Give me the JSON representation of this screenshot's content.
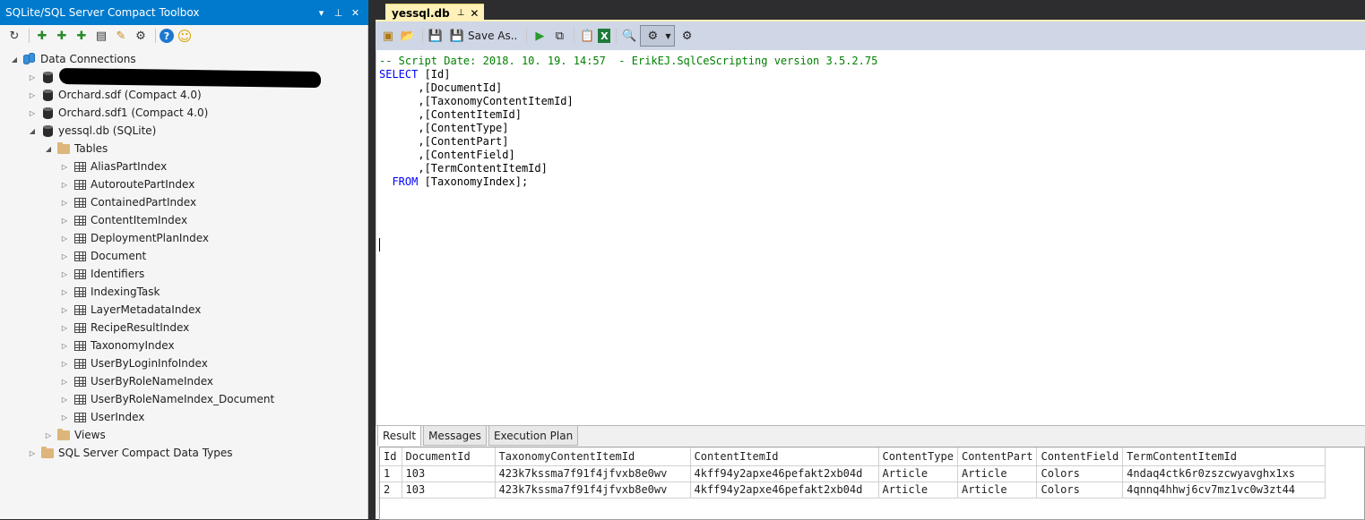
{
  "panel": {
    "title": "SQLite/SQL Server Compact Toolbox",
    "title_buttons": [
      "▾",
      "⊥",
      "✕"
    ],
    "toolbar_icons": [
      "refresh-icon",
      "add-sqlite-connection-icon",
      "add-ce-connection-icon",
      "add-server-connection-icon",
      "scan-icon",
      "script-icon",
      "settings-icon",
      "help-icon",
      "smiley-icon"
    ],
    "toolbar_glyphs": [
      "↻",
      "✚",
      "✚",
      "✚",
      "▤",
      "✎",
      "⚙",
      "?",
      "☺"
    ]
  },
  "tree": {
    "root_label": "Data Connections",
    "connections": [
      {
        "label": "",
        "redacted": true
      },
      {
        "label": "Orchard.sdf (Compact 4.0)"
      },
      {
        "label": "Orchard.sdf1 (Compact 4.0)"
      },
      {
        "label": "yessql.db (SQLite)"
      }
    ],
    "tables_label": "Tables",
    "tables": [
      "AliasPartIndex",
      "AutoroutePartIndex",
      "ContainedPartIndex",
      "ContentItemIndex",
      "DeploymentPlanIndex",
      "Document",
      "Identifiers",
      "IndexingTask",
      "LayerMetadataIndex",
      "RecipeResultIndex",
      "TaxonomyIndex",
      "UserByLoginInfoIndex",
      "UserByRoleNameIndex",
      "UserByRoleNameIndex_Document",
      "UserIndex"
    ],
    "views_label": "Views",
    "data_types_label": "SQL Server Compact Data Types"
  },
  "document_tab": {
    "label": "yessql.db",
    "pin": "⊥",
    "close": "✕"
  },
  "editor_toolbar": {
    "save_as_label": "Save As..",
    "glyphs": {
      "new": "▣",
      "open": "📂",
      "save": "💾",
      "save_as": "💾",
      "execute": "▶",
      "plan": "⧉",
      "clipboard": "📋",
      "excel": "X",
      "find": "🔍",
      "options": "⚙",
      "extra": "⚙"
    }
  },
  "code": [
    {
      "kind": "cm",
      "text": "-- Script Date: 2018. 10. 19. 14:57  - ErikEJ.SqlCeScripting version 3.5.2.75"
    },
    {
      "kind": "kw-first",
      "kw": "SELECT",
      "text": " [Id]"
    },
    {
      "kind": "pl",
      "text": "      ,[DocumentId]"
    },
    {
      "kind": "pl",
      "text": "      ,[TaxonomyContentItemId]"
    },
    {
      "kind": "pl",
      "text": "      ,[ContentItemId]"
    },
    {
      "kind": "pl",
      "text": "      ,[ContentType]"
    },
    {
      "kind": "pl",
      "text": "      ,[ContentPart]"
    },
    {
      "kind": "pl",
      "text": "      ,[ContentField]"
    },
    {
      "kind": "pl",
      "text": "      ,[TermContentItemId]"
    },
    {
      "kind": "kw-indent",
      "kw": "FROM",
      "text": " [TaxonomyIndex];"
    }
  ],
  "results": {
    "tabs": [
      "Result",
      "Messages",
      "Execution Plan"
    ],
    "columns": [
      "Id",
      "DocumentId",
      "TaxonomyContentItemId",
      "ContentItemId",
      "ContentType",
      "ContentPart",
      "ContentField",
      "TermContentItemId"
    ],
    "rows": [
      [
        "1",
        "103",
        "423k7kssma7f91f4jfvxb8e0wv",
        "4kff94y2apxe46pefakt2xb04d",
        "Article",
        "Article",
        "Colors",
        "4ndaq4ctk6r0zszcwyavghx1xs"
      ],
      [
        "2",
        "103",
        "423k7kssma7f91f4jfvxb8e0wv",
        "4kff94y2apxe46pefakt2xb04d",
        "Article",
        "Article",
        "Colors",
        "4qnnq4hhwj6cv7mz1vc0w3zt44"
      ]
    ]
  },
  "colors": {
    "accent": "#007acc",
    "tab_active": "#fff1b8",
    "toolbar": "#cfd6e5",
    "comment": "#008000",
    "keyword": "#0000ff"
  }
}
